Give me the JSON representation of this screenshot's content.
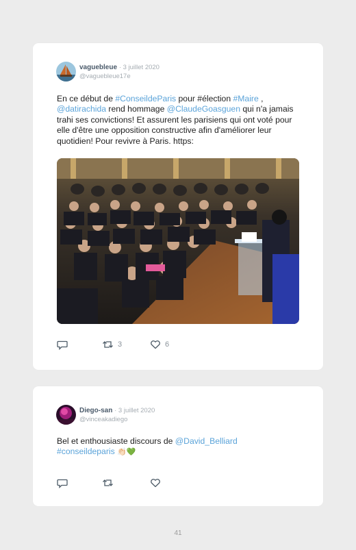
{
  "tweets": [
    {
      "name": "vaguebleue",
      "date": "· 3 juillet 2020",
      "handle": "@vaguebleue17e",
      "text": {
        "t1": "En ce début de ",
        "l1": "#ConseildeParis",
        "t2": " pour #élection ",
        "l2": "#Maire",
        "t3": " , ",
        "l3": "@datirachida",
        "t4": " rend hommage ",
        "l4": "@ClaudeGoasguen",
        "t5": " qui n'a jamais trahi ses convictions! Et assurent les parisiens qui ont voté pour elle d'être une opposition constructive afin d'améliorer leur quotidien! Pour revivre à Paris. https:"
      },
      "retweets": "3",
      "likes": "6",
      "image_icon": "council-hall-photo"
    },
    {
      "name": "Diego-san",
      "date": "· 3 juillet 2020",
      "handle": "@vinceakadiego",
      "text": {
        "t1": "Bel et enthousiaste discours de ",
        "l1": "@David_Belliard",
        "l2": "#conseildeparis",
        "emoji": "👏🏻💚"
      },
      "retweets": "",
      "likes": ""
    }
  ],
  "page_number": "41",
  "colors": {
    "link": "#5aa3d9",
    "meta": "#a5acb2",
    "background": "#ececec"
  }
}
